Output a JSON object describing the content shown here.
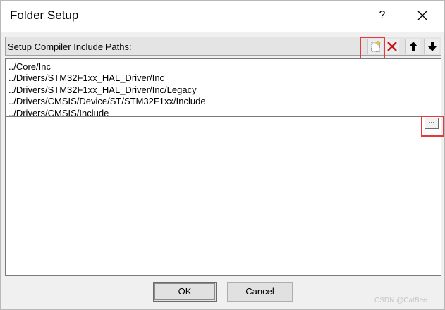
{
  "window": {
    "title": "Folder Setup",
    "help_label": "?"
  },
  "header": {
    "label": "Setup Compiler Include Paths:"
  },
  "toolbar": {
    "icons": [
      "new-folder-icon",
      "delete-icon",
      "move-up-icon",
      "move-down-icon"
    ]
  },
  "paths": [
    "../Core/Inc",
    "../Drivers/STM32F1xx_HAL_Driver/Inc",
    "../Drivers/STM32F1xx_HAL_Driver/Inc/Legacy",
    "../Drivers/CMSIS/Device/ST/STM32F1xx/Include",
    "../Drivers/CMSIS/Include"
  ],
  "edit_row": {
    "value": "",
    "browse_label": "..."
  },
  "buttons": {
    "ok": "OK",
    "cancel": "Cancel"
  },
  "watermark": "CSDN @CatBee",
  "colors": {
    "highlight": "#e5383a",
    "delete": "#c0181a"
  }
}
